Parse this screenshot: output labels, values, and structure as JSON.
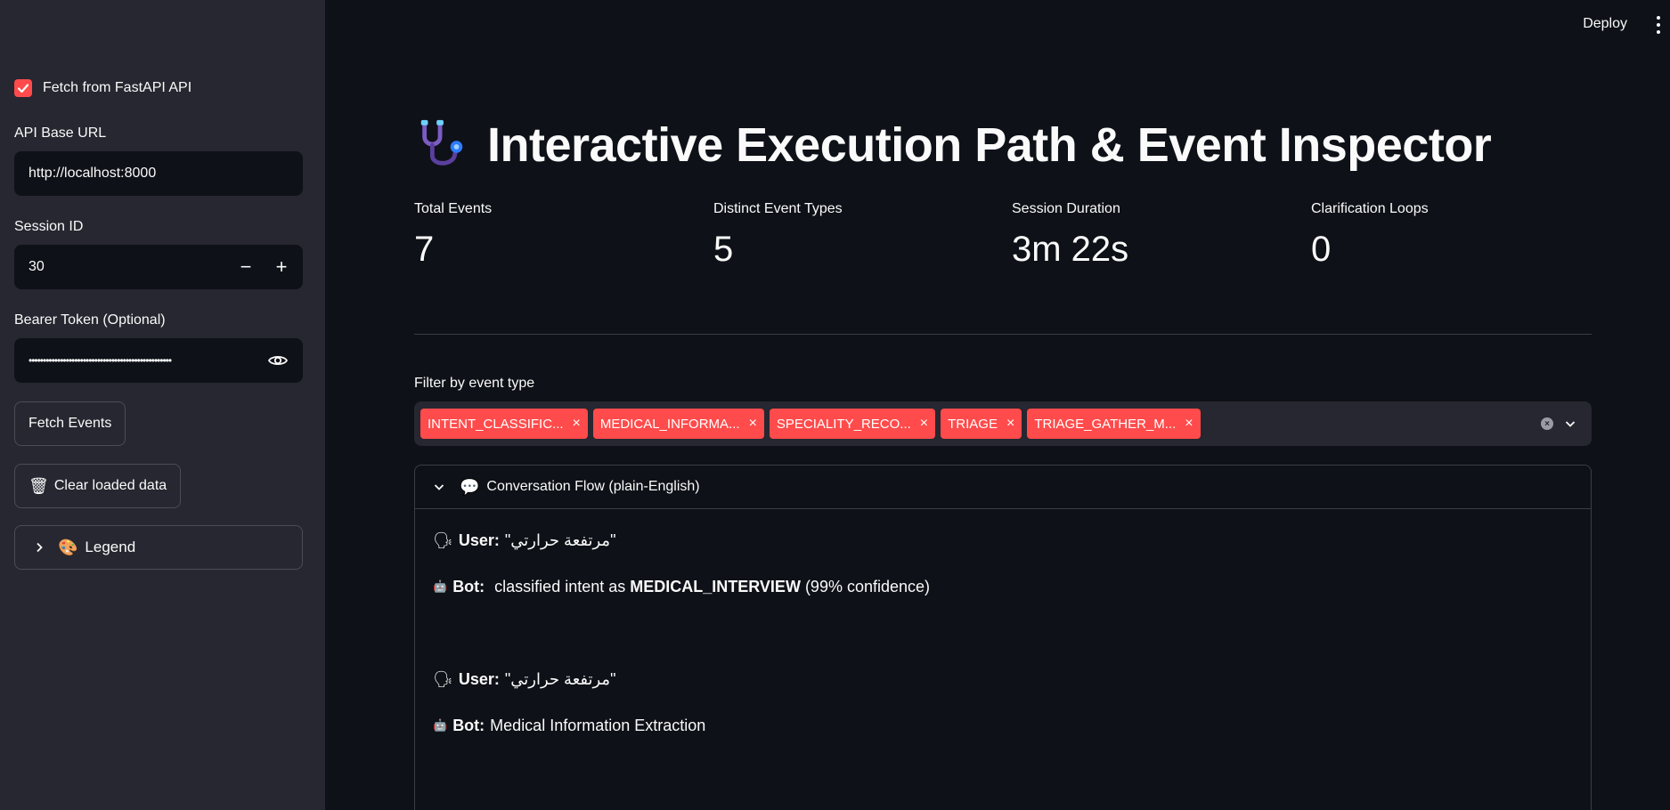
{
  "sidebar": {
    "fetch_checkbox_label": "Fetch from FastAPI API",
    "fetch_checked": true,
    "api_base_url_label": "API Base URL",
    "api_base_url_value": "http://localhost:8000",
    "session_id_label": "Session ID",
    "session_id_value": "30",
    "bearer_label": "Bearer Token (Optional)",
    "bearer_value": "••••••••••••••••••••••••••••••••••••••••••••••••••",
    "fetch_button": "Fetch Events",
    "clear_icon": "🗑",
    "clear_button": "Clear loaded data",
    "legend_icon": "🎨",
    "legend_label": "Legend"
  },
  "header": {
    "deploy": "Deploy"
  },
  "main": {
    "title": "Interactive Execution Path & Event Inspector",
    "metrics": [
      {
        "label": "Total Events",
        "value": "7"
      },
      {
        "label": "Distinct Event Types",
        "value": "5"
      },
      {
        "label": "Session Duration",
        "value": "3m 22s"
      },
      {
        "label": "Clarification Loops",
        "value": "0"
      }
    ],
    "filter_label": "Filter by event type",
    "filter_tags": [
      "INTENT_CLASSIFIC...",
      "MEDICAL_INFORMA...",
      "SPECIALITY_RECO...",
      "TRIAGE",
      "TRIAGE_GATHER_M..."
    ],
    "expander_icon": "💬",
    "expander_label": "Conversation Flow (plain-English)",
    "messages": [
      {
        "icon": "🗣",
        "speaker": "User:",
        "text": " \"مرتفعة حرارتي\""
      },
      {
        "icon": "🤖",
        "speaker": "Bot:",
        "text": " classified intent as ",
        "bold": "MEDICAL_INTERVIEW",
        "tail": " (99% confidence)"
      },
      {
        "icon": "🗣",
        "speaker": "User:",
        "text": " \"مرتفعة حرارتي\""
      },
      {
        "icon": "🤖",
        "speaker": "Bot:",
        "text": " Medical Information Extraction"
      }
    ]
  },
  "colors": {
    "accent": "#ff4b4b",
    "background": "#0e1117",
    "sidebar": "#262730"
  }
}
